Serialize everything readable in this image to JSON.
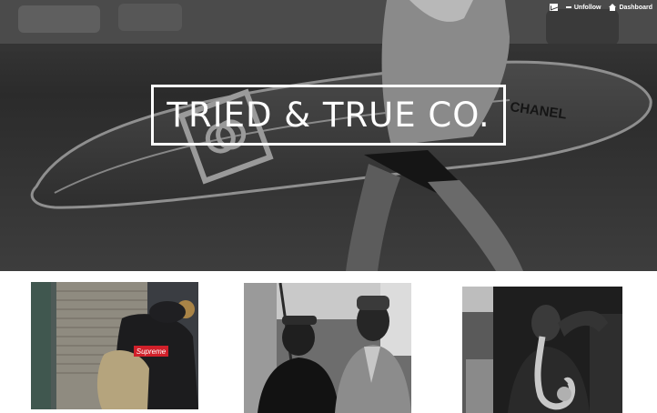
{
  "header": {
    "blog_title": "TRIED & TRUE CO.",
    "controls": [
      {
        "label": "",
        "icon": "mail-icon"
      },
      {
        "label": "Unfollow",
        "icon": "minus-icon"
      },
      {
        "label": "Dashboard",
        "icon": "home-icon"
      }
    ],
    "surfboard_text": "CHANEL"
  },
  "posts": [
    {
      "image_text": "Supreme"
    },
    {
      "image_text": ""
    },
    {
      "image_text": ""
    }
  ],
  "colors": {
    "hero_overlay": "#2a2a2a",
    "text": "#ffffff",
    "page_background": "#ffffff",
    "supreme_red": "#d0202a"
  }
}
